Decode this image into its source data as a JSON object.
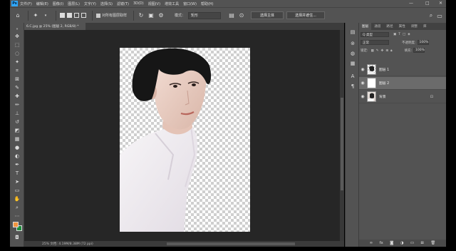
{
  "menubar": {
    "logo": "Ps",
    "items": [
      "文件(F)",
      "编辑(E)",
      "图像(I)",
      "图层(L)",
      "文字(Y)",
      "选择(S)",
      "滤镜(T)",
      "3D(D)",
      "视图(V)",
      "增效工具",
      "窗口(W)",
      "帮助(H)"
    ],
    "minimize": "—",
    "maximize": "□",
    "close": "✕"
  },
  "options": {
    "sample_all_layers": "对所有图层取样",
    "mode_label": "模式：",
    "mode_value": "矩形",
    "select_subject": "选择主体",
    "select_and_mask": "选择并遮住..."
  },
  "document": {
    "tab_title": "6.C.jpg @ 25% (图层 2, RGB/8) *",
    "status": "25% 文档: 4.19M/8.38M (72 ppi)"
  },
  "layers_panel": {
    "tabs": [
      "图层",
      "通道",
      "路径",
      "属性",
      "调整",
      "库"
    ],
    "filter_label": "Q 类型",
    "blend_mode": "正常",
    "opacity_label": "不透明度:",
    "opacity_value": "100%",
    "lock_label": "锁定:",
    "fill_label": "填充:",
    "fill_value": "100%",
    "layers": [
      {
        "name": "图层 1",
        "visible": true,
        "selected": false
      },
      {
        "name": "图层 2",
        "visible": true,
        "selected": true
      },
      {
        "name": "背景",
        "visible": true,
        "selected": false,
        "locked": true
      }
    ]
  },
  "colors": {
    "foreground": "#f29640",
    "background": "#1c8c3c",
    "ui_dark": "#262626",
    "ui_panel": "#535353",
    "accent": "#31a8ff"
  }
}
